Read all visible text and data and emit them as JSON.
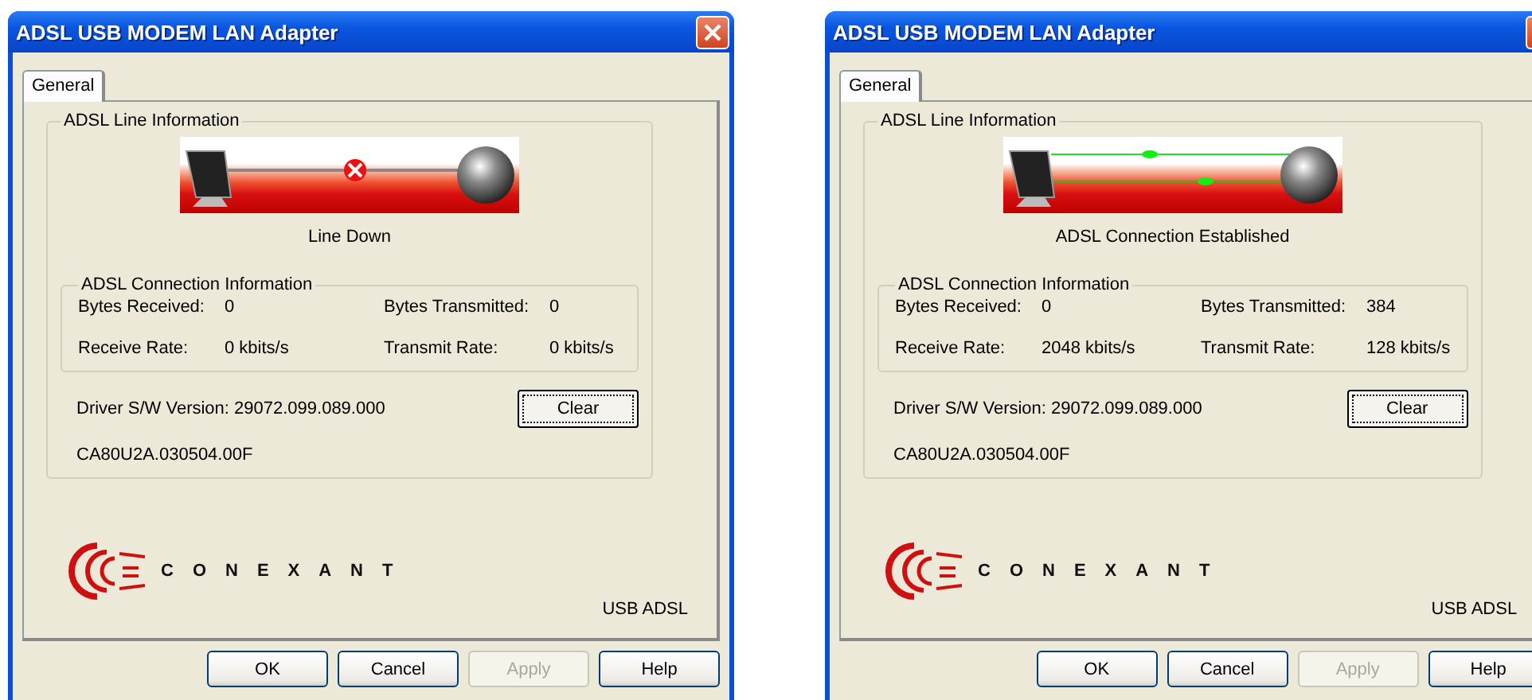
{
  "windows": [
    {
      "title": "ADSL USB MODEM LAN Adapter",
      "tabs": [
        {
          "label": "General",
          "selected": true
        }
      ],
      "line_group": "ADSL Line Information",
      "line_drawing": {
        "kind": "down"
      },
      "status_text": "Line Down",
      "connection_group": "ADSL Connection Information",
      "stats": [
        {
          "label": "Bytes Received:",
          "value": "0"
        },
        {
          "label": "Bytes Transmitted:",
          "value": "0"
        },
        {
          "label": "Receive Rate:",
          "value": "0 kbits/s"
        },
        {
          "label": "Transmit Rate:",
          "value": "0 kbits/s"
        }
      ],
      "driver_version": "Driver S/W Version: 29072.099.089.000",
      "clear_button": "Clear",
      "firmware": "CA80U2A.030504.00F",
      "brand": "CONEXANT",
      "product": "USB ADSL",
      "buttons": [
        {
          "label": "OK",
          "disabled": false
        },
        {
          "label": "Cancel",
          "disabled": false
        },
        {
          "label": "Apply",
          "disabled": true
        },
        {
          "label": "Help",
          "disabled": false
        }
      ]
    },
    {
      "title": "ADSL USB MODEM LAN Adapter",
      "tabs": [
        {
          "label": "General",
          "selected": true
        }
      ],
      "line_group": "ADSL Line Information",
      "line_drawing": {
        "kind": "up"
      },
      "status_text": "ADSL Connection Established",
      "connection_group": "ADSL Connection Information",
      "stats": [
        {
          "label": "Bytes Received:",
          "value": "0"
        },
        {
          "label": "Bytes Transmitted:",
          "value": "384"
        },
        {
          "label": "Receive Rate:",
          "value": "2048 kbits/s"
        },
        {
          "label": "Transmit Rate:",
          "value": "128 kbits/s"
        }
      ],
      "driver_version": "Driver S/W Version: 29072.099.089.000",
      "clear_button": "Clear",
      "firmware": "CA80U2A.030504.00F",
      "brand": "CONEXANT",
      "product": "USB ADSL",
      "buttons": [
        {
          "label": "OK",
          "disabled": false
        },
        {
          "label": "Cancel",
          "disabled": false
        },
        {
          "label": "Apply",
          "disabled": true
        },
        {
          "label": "Help",
          "disabled": false
        }
      ]
    }
  ]
}
